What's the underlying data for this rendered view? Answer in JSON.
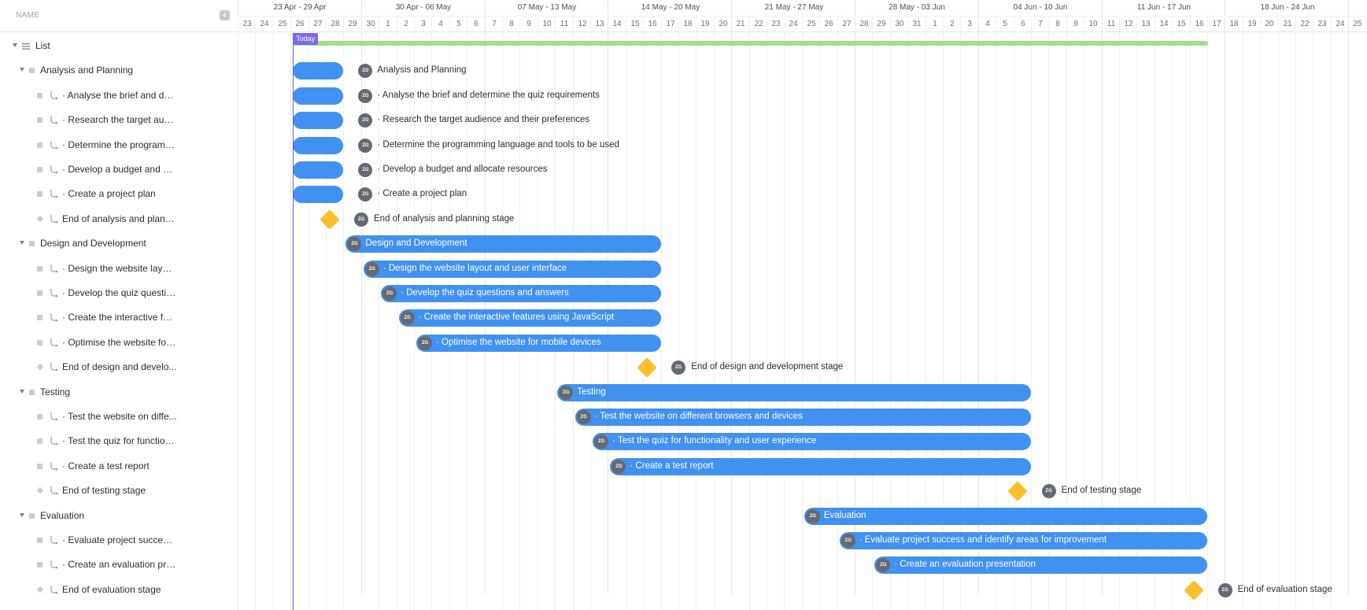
{
  "sidebar": {
    "title": "NAME",
    "add_icon": "+",
    "rows": [
      {
        "label": "List",
        "kind": "list"
      },
      {
        "label": "Analysis and Planning",
        "kind": "group"
      },
      {
        "label": "· Analyse the brief and det...",
        "kind": "task"
      },
      {
        "label": "· Research the target audi...",
        "kind": "task"
      },
      {
        "label": "· Determine the programm...",
        "kind": "task"
      },
      {
        "label": "· Develop a budget and all...",
        "kind": "task"
      },
      {
        "label": "· Create a project plan",
        "kind": "task"
      },
      {
        "label": "End of analysis and planni...",
        "kind": "milestone"
      },
      {
        "label": "Design and Development",
        "kind": "group"
      },
      {
        "label": "· Design the website layou...",
        "kind": "task"
      },
      {
        "label": "· Develop the quiz questio...",
        "kind": "task"
      },
      {
        "label": "· Create the interactive fea...",
        "kind": "task"
      },
      {
        "label": "· Optimise the website for ...",
        "kind": "task"
      },
      {
        "label": "End of design and develo...",
        "kind": "milestone"
      },
      {
        "label": "Testing",
        "kind": "group"
      },
      {
        "label": "· Test the website on diffe...",
        "kind": "task"
      },
      {
        "label": "· Test the quiz for function...",
        "kind": "task"
      },
      {
        "label": "· Create a test report",
        "kind": "task"
      },
      {
        "label": "End of testing stage",
        "kind": "milestone"
      },
      {
        "label": "Evaluation",
        "kind": "group"
      },
      {
        "label": "· Evaluate project success ...",
        "kind": "task"
      },
      {
        "label": "· Create an evaluation pre...",
        "kind": "task"
      },
      {
        "label": "End of evaluation stage",
        "kind": "milestone"
      }
    ]
  },
  "timeline": {
    "today_label": "Today",
    "weeks": [
      "23 Apr - 29 Apr",
      "30 Apr - 06 May",
      "07 May - 13 May",
      "14 May - 20 May",
      "21 May - 27 May",
      "28 May - 03 Jun",
      "04 Jun - 10 Jun",
      "11 Jun - 17 Jun",
      "18 Jun - 24 Jun"
    ],
    "days": [
      "23",
      "24",
      "25",
      "26",
      "27",
      "28",
      "29",
      "30",
      "1",
      "2",
      "3",
      "4",
      "5",
      "6",
      "7",
      "8",
      "9",
      "10",
      "11",
      "12",
      "13",
      "14",
      "15",
      "16",
      "17",
      "18",
      "19",
      "20",
      "21",
      "22",
      "23",
      "24",
      "25",
      "26",
      "27",
      "28",
      "29",
      "30",
      "31",
      "1",
      "2",
      "3",
      "4",
      "5",
      "6",
      "7",
      "8",
      "9",
      "10",
      "11",
      "12",
      "13",
      "14",
      "15",
      "16",
      "17",
      "18",
      "19",
      "20",
      "21",
      "22",
      "23",
      "24",
      "25"
    ],
    "today_date": "26 Apr",
    "list_span": {
      "start": "26 Apr",
      "end": "17 Jun"
    },
    "items": [
      {
        "label": "Analysis and Planning",
        "start": "26 Apr",
        "end": "28 Apr",
        "type": "bar",
        "avatar": "ZG"
      },
      {
        "label": "· Analyse the brief and determine the quiz requirements",
        "start": "26 Apr",
        "end": "28 Apr",
        "type": "bar",
        "avatar": "ZG"
      },
      {
        "label": "· Research the target audience and their preferences",
        "start": "26 Apr",
        "end": "28 Apr",
        "type": "bar",
        "avatar": "ZG"
      },
      {
        "label": "· Determine the programming language and tools to be used",
        "start": "26 Apr",
        "end": "28 Apr",
        "type": "bar",
        "avatar": "ZG"
      },
      {
        "label": "· Develop a budget and allocate resources",
        "start": "26 Apr",
        "end": "28 Apr",
        "type": "bar",
        "avatar": "ZG"
      },
      {
        "label": "· Create a project plan",
        "start": "26 Apr",
        "end": "28 Apr",
        "type": "bar",
        "avatar": "ZG"
      },
      {
        "label": "End of analysis and planning stage",
        "date": "28 Apr",
        "type": "milestone",
        "avatar": "ZG"
      },
      {
        "label": "Design and Development",
        "start": "29 Apr",
        "end": "16 May",
        "type": "bar",
        "avatar": "ZG"
      },
      {
        "label": "· Design the website layout and user interface",
        "start": "30 Apr",
        "end": "16 May",
        "type": "bar",
        "avatar": "ZG"
      },
      {
        "label": "· Develop the quiz questions and answers",
        "start": "1 May",
        "end": "16 May",
        "type": "bar",
        "avatar": "ZG"
      },
      {
        "label": "· Create the interactive features using JavaScript",
        "start": "2 May",
        "end": "16 May",
        "type": "bar",
        "avatar": "ZG"
      },
      {
        "label": "· Optimise the website for mobile devices",
        "start": "3 May",
        "end": "16 May",
        "type": "bar",
        "avatar": "ZG"
      },
      {
        "label": "End of design and development stage",
        "date": "16 May",
        "type": "milestone",
        "avatar": "ZG"
      },
      {
        "label": "Testing",
        "start": "11 May",
        "end": "6 Jun",
        "type": "bar",
        "avatar": "ZG"
      },
      {
        "label": "· Test the website on different browsers and devices",
        "start": "12 May",
        "end": "6 Jun",
        "type": "bar",
        "avatar": "ZG"
      },
      {
        "label": "· Test the quiz for functionality and user experience",
        "start": "13 May",
        "end": "6 Jun",
        "type": "bar",
        "avatar": "ZG"
      },
      {
        "label": "· Create a test report",
        "start": "14 May",
        "end": "6 Jun",
        "type": "bar",
        "avatar": "ZG"
      },
      {
        "label": "End of testing stage",
        "date": "6 Jun",
        "type": "milestone",
        "avatar": "ZG"
      },
      {
        "label": "Evaluation",
        "start": "25 May",
        "end": "16 Jun",
        "type": "bar",
        "avatar": "ZG"
      },
      {
        "label": "· Evaluate project success and identify areas for improvement",
        "start": "27 May",
        "end": "16 Jun",
        "type": "bar",
        "avatar": "ZG"
      },
      {
        "label": "· Create an evaluation presentation",
        "start": "29 May",
        "end": "16 Jun",
        "type": "bar",
        "avatar": "ZG"
      },
      {
        "label": "End of evaluation stage",
        "date": "16 Jun",
        "type": "milestone",
        "avatar": "ZG"
      }
    ]
  },
  "colors": {
    "bar": "#4191f0",
    "milestone": "#fbbf2c",
    "list_bar": "#a6dc8b",
    "today": "#7b68ee",
    "avatar": "#656a72"
  },
  "icons": {
    "caret": "caret-down-icon",
    "task": "subtask-link-icon",
    "add": "plus-icon",
    "list": "list-icon",
    "milestone": "diamond-icon"
  }
}
